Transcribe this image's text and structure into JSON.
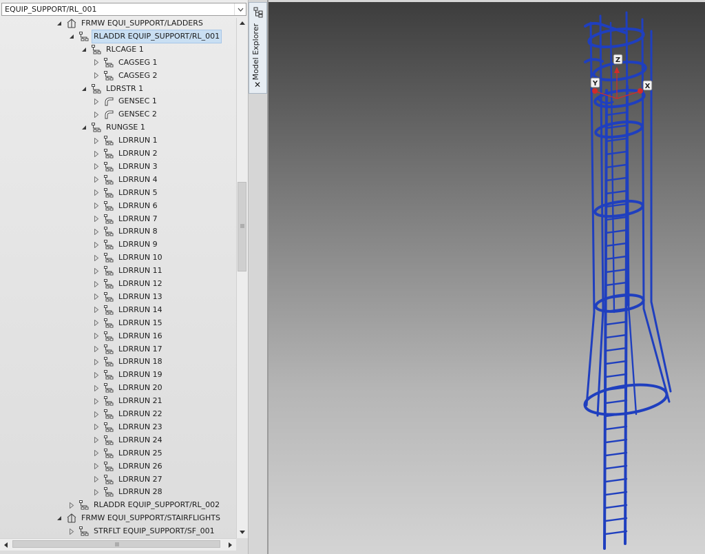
{
  "path_combo": {
    "value": "EQUIP_SUPPORT/RL_001"
  },
  "side_tab": {
    "label": "Model Explorer",
    "close": "✕"
  },
  "tree": {
    "items": [
      {
        "label": "FRMW EQUI_SUPPORT/LADDERS",
        "level": 0,
        "state": "expanded",
        "icon": "framework-icon"
      },
      {
        "label": "RLADDR EQUIP_SUPPORT/RL_001",
        "level": 1,
        "state": "expanded",
        "icon": "hierarchy-icon",
        "selected": true
      },
      {
        "label": "RLCAGE 1",
        "level": 2,
        "state": "expanded",
        "icon": "hierarchy-icon"
      },
      {
        "label": "CAGSEG 1",
        "level": 3,
        "state": "collapsed",
        "icon": "hierarchy-icon"
      },
      {
        "label": "CAGSEG 2",
        "level": 3,
        "state": "collapsed",
        "icon": "hierarchy-icon"
      },
      {
        "label": "LDRSTR 1",
        "level": 2,
        "state": "expanded",
        "icon": "hierarchy-icon"
      },
      {
        "label": "GENSEC 1",
        "level": 3,
        "state": "collapsed",
        "icon": "section-icon"
      },
      {
        "label": "GENSEC 2",
        "level": 3,
        "state": "collapsed",
        "icon": "section-icon"
      },
      {
        "label": "RUNGSE 1",
        "level": 2,
        "state": "expanded",
        "icon": "hierarchy-icon"
      },
      {
        "label": "LDRRUN 1",
        "level": 3,
        "state": "collapsed",
        "icon": "hierarchy-icon"
      },
      {
        "label": "LDRRUN 2",
        "level": 3,
        "state": "collapsed",
        "icon": "hierarchy-icon"
      },
      {
        "label": "LDRRUN 3",
        "level": 3,
        "state": "collapsed",
        "icon": "hierarchy-icon"
      },
      {
        "label": "LDRRUN 4",
        "level": 3,
        "state": "collapsed",
        "icon": "hierarchy-icon"
      },
      {
        "label": "LDRRUN 5",
        "level": 3,
        "state": "collapsed",
        "icon": "hierarchy-icon"
      },
      {
        "label": "LDRRUN 6",
        "level": 3,
        "state": "collapsed",
        "icon": "hierarchy-icon"
      },
      {
        "label": "LDRRUN 7",
        "level": 3,
        "state": "collapsed",
        "icon": "hierarchy-icon"
      },
      {
        "label": "LDRRUN 8",
        "level": 3,
        "state": "collapsed",
        "icon": "hierarchy-icon"
      },
      {
        "label": "LDRRUN 9",
        "level": 3,
        "state": "collapsed",
        "icon": "hierarchy-icon"
      },
      {
        "label": "LDRRUN 10",
        "level": 3,
        "state": "collapsed",
        "icon": "hierarchy-icon"
      },
      {
        "label": "LDRRUN 11",
        "level": 3,
        "state": "collapsed",
        "icon": "hierarchy-icon"
      },
      {
        "label": "LDRRUN 12",
        "level": 3,
        "state": "collapsed",
        "icon": "hierarchy-icon"
      },
      {
        "label": "LDRRUN 13",
        "level": 3,
        "state": "collapsed",
        "icon": "hierarchy-icon"
      },
      {
        "label": "LDRRUN 14",
        "level": 3,
        "state": "collapsed",
        "icon": "hierarchy-icon"
      },
      {
        "label": "LDRRUN 15",
        "level": 3,
        "state": "collapsed",
        "icon": "hierarchy-icon"
      },
      {
        "label": "LDRRUN 16",
        "level": 3,
        "state": "collapsed",
        "icon": "hierarchy-icon"
      },
      {
        "label": "LDRRUN 17",
        "level": 3,
        "state": "collapsed",
        "icon": "hierarchy-icon"
      },
      {
        "label": "LDRRUN 18",
        "level": 3,
        "state": "collapsed",
        "icon": "hierarchy-icon"
      },
      {
        "label": "LDRRUN 19",
        "level": 3,
        "state": "collapsed",
        "icon": "hierarchy-icon"
      },
      {
        "label": "LDRRUN 20",
        "level": 3,
        "state": "collapsed",
        "icon": "hierarchy-icon"
      },
      {
        "label": "LDRRUN 21",
        "level": 3,
        "state": "collapsed",
        "icon": "hierarchy-icon"
      },
      {
        "label": "LDRRUN 22",
        "level": 3,
        "state": "collapsed",
        "icon": "hierarchy-icon"
      },
      {
        "label": "LDRRUN 23",
        "level": 3,
        "state": "collapsed",
        "icon": "hierarchy-icon"
      },
      {
        "label": "LDRRUN 24",
        "level": 3,
        "state": "collapsed",
        "icon": "hierarchy-icon"
      },
      {
        "label": "LDRRUN 25",
        "level": 3,
        "state": "collapsed",
        "icon": "hierarchy-icon"
      },
      {
        "label": "LDRRUN 26",
        "level": 3,
        "state": "collapsed",
        "icon": "hierarchy-icon"
      },
      {
        "label": "LDRRUN 27",
        "level": 3,
        "state": "collapsed",
        "icon": "hierarchy-icon"
      },
      {
        "label": "LDRRUN 28",
        "level": 3,
        "state": "collapsed",
        "icon": "hierarchy-icon"
      },
      {
        "label": "RLADDR EQUIP_SUPPORT/RL_002",
        "level": 1,
        "state": "collapsed",
        "icon": "hierarchy-icon"
      },
      {
        "label": "FRMW EQUI_SUPPORT/STAIRFLIGHTS",
        "level": 0,
        "state": "expanded",
        "icon": "framework-icon"
      },
      {
        "label": "STRFLT EQUIP_SUPPORT/SF_001",
        "level": 1,
        "state": "collapsed",
        "icon": "hierarchy-icon"
      }
    ]
  },
  "viewport": {
    "axes": {
      "x": "X",
      "y": "Y",
      "z": "Z"
    },
    "model_color": "#1f3fbf",
    "axis_color": "#d22b2b"
  }
}
